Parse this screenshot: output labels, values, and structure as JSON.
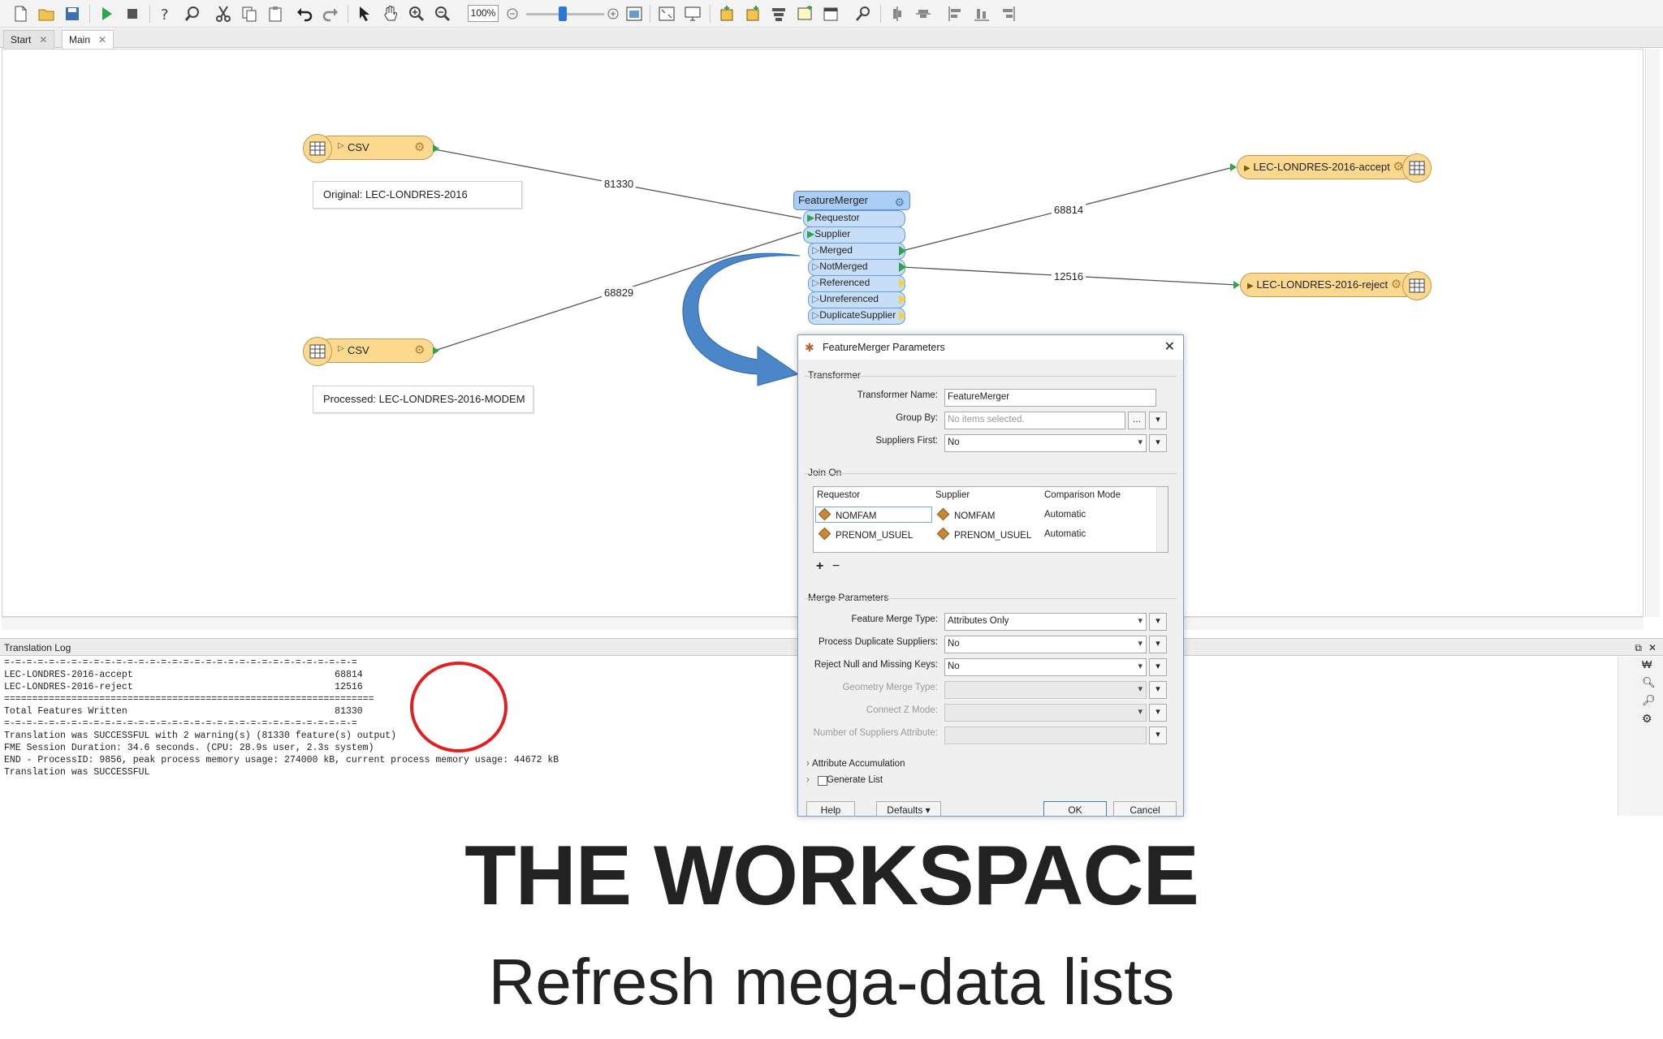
{
  "toolbar": {
    "zoom": "100%"
  },
  "tabs": [
    {
      "label": "Start"
    },
    {
      "label": "Main"
    }
  ],
  "canvas": {
    "reader1": {
      "name": "CSV",
      "annotation": "Original: LEC-LONDRES-2016"
    },
    "reader2": {
      "name": "CSV",
      "annotation": "Processed: LEC-LONDRES-2016-MODEM"
    },
    "link_counts": {
      "reader1": "81330",
      "reader2": "68829",
      "merged": "68814",
      "notmerged": "12516"
    },
    "transformer": {
      "name": "FeatureMerger",
      "inputs": [
        "Requestor",
        "Supplier"
      ],
      "outputs": [
        "Merged",
        "NotMerged",
        "Referenced",
        "Unreferenced",
        "DuplicateSupplier"
      ]
    },
    "writer_accept": "LEC-LONDRES-2016-accept",
    "writer_reject": "LEC-LONDRES-2016-reject"
  },
  "log": {
    "title": "Translation Log",
    "lines": [
      "=-=-=-=-=-=-=-=-=-=-=-=-=-=-=-=-=-=-=-=-=-=-=-=-=-=-=-=-=-=-=-=",
      "LEC-LONDRES-2016-accept                                    68814",
      "LEC-LONDRES-2016-reject                                    12516",
      "==================================================================",
      "Total Features Written                                     81330",
      "=-=-=-=-=-=-=-=-=-=-=-=-=-=-=-=-=-=-=-=-=-=-=-=-=-=-=-=-=-=-=-=",
      "Translation was SUCCESSFUL with 2 warning(s) (81330 feature(s) output)",
      "FME Session Duration: 34.6 seconds. (CPU: 28.9s user, 2.3s system)",
      "END - ProcessID: 9856, peak process memory usage: 274000 kB, current process memory usage: 44672 kB",
      "Translation was SUCCESSFUL"
    ]
  },
  "dialog": {
    "title": "FeatureMerger Parameters",
    "transformer_group": "Transformer",
    "transformer_name_label": "Transformer Name:",
    "transformer_name_value": "FeatureMerger",
    "group_by_label": "Group By:",
    "group_by_placeholder": "No items selected.",
    "suppliers_first_label": "Suppliers First:",
    "suppliers_first_value": "No",
    "join_on_group": "Join On",
    "join_headers": {
      "requestor": "Requestor",
      "supplier": "Supplier",
      "mode": "Comparison Mode"
    },
    "join_rows": [
      {
        "requestor": "NOMFAM",
        "supplier": "NOMFAM",
        "mode": "Automatic"
      },
      {
        "requestor": "PRENOM_USUEL",
        "supplier": "PRENOM_USUEL",
        "mode": "Automatic"
      }
    ],
    "merge_group": "Merge Parameters",
    "feature_merge_type_label": "Feature Merge Type:",
    "feature_merge_type_value": "Attributes Only",
    "process_duplicate_label": "Process Duplicate Suppliers:",
    "process_duplicate_value": "No",
    "reject_null_label": "Reject Null and Missing Keys:",
    "reject_null_value": "No",
    "geometry_merge_label": "Geometry Merge Type:",
    "connect_z_label": "Connect Z Mode:",
    "num_suppliers_label": "Number of Suppliers Attribute:",
    "attribute_accumulation": "Attribute Accumulation",
    "generate_list": "Generate List",
    "help": "Help",
    "defaults": "Defaults",
    "ok": "OK",
    "cancel": "Cancel"
  },
  "slide": {
    "title": "THE WORKSPACE",
    "subtitle": "Refresh mega-data lists"
  },
  "colors": {
    "reader_fill": "#fcd98f",
    "transformer_fill": "#a9cdf4",
    "annotation_circle": "#e02020",
    "arrow_fill": "#4a86c8"
  }
}
